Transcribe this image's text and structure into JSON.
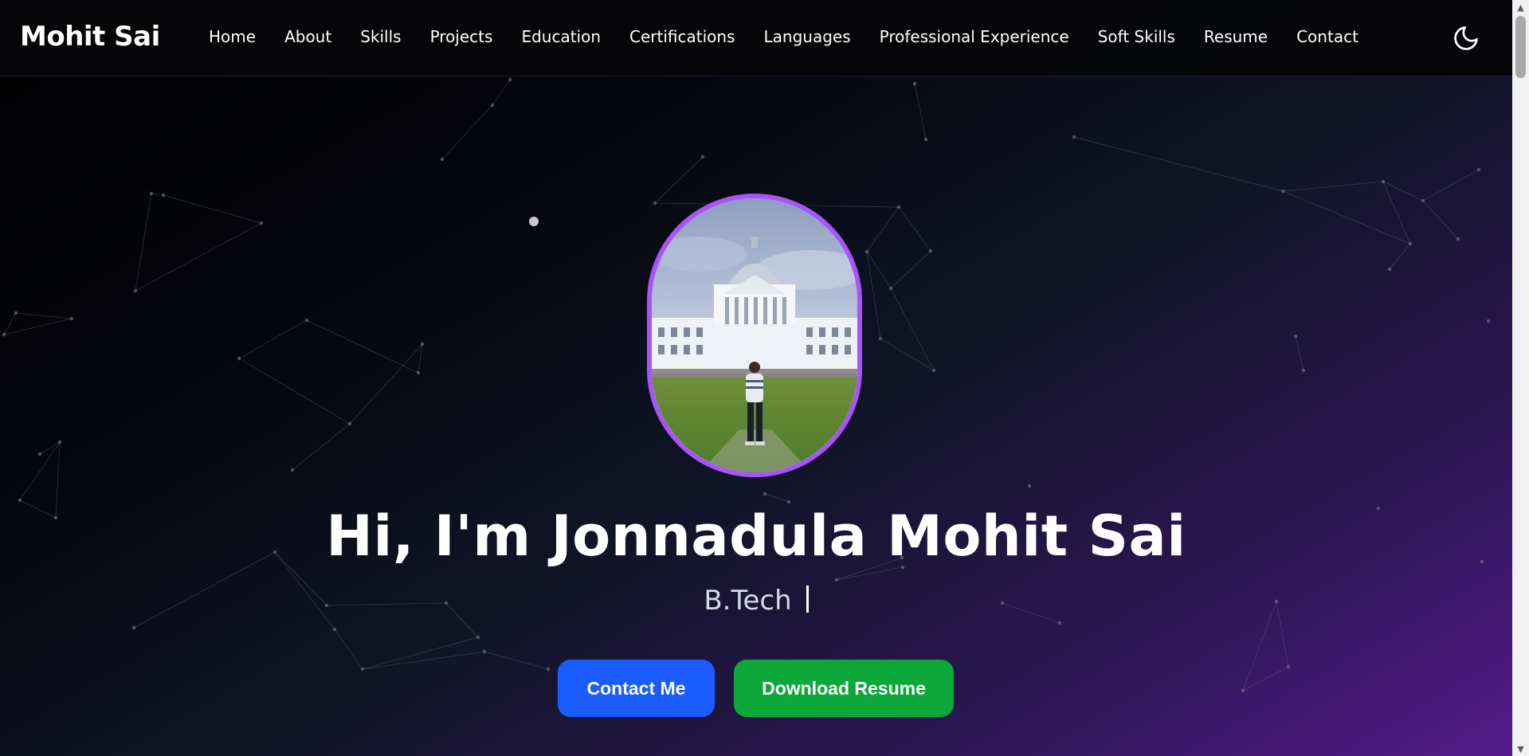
{
  "navbar": {
    "brand": "Mohit Sai",
    "links": [
      {
        "label": "Home"
      },
      {
        "label": "About"
      },
      {
        "label": "Skills"
      },
      {
        "label": "Projects"
      },
      {
        "label": "Education"
      },
      {
        "label": "Certifications"
      },
      {
        "label": "Languages"
      },
      {
        "label": "Professional Experience"
      },
      {
        "label": "Soft Skills"
      },
      {
        "label": "Resume"
      },
      {
        "label": "Contact"
      }
    ],
    "theme_toggle_icon": "moon-icon"
  },
  "hero": {
    "title": "Hi, I'm Jonnadula Mohit Sai",
    "subtitle": "B.Tech",
    "contact_button": "Contact Me",
    "resume_button": "Download Resume",
    "profile_photo_icon": "profile-photo"
  },
  "colors": {
    "accent_border": "#a855f7",
    "contact_button": "#1a5cff",
    "resume_button": "#0ca83a",
    "background_start": "#000000",
    "background_end": "#551a8b"
  }
}
